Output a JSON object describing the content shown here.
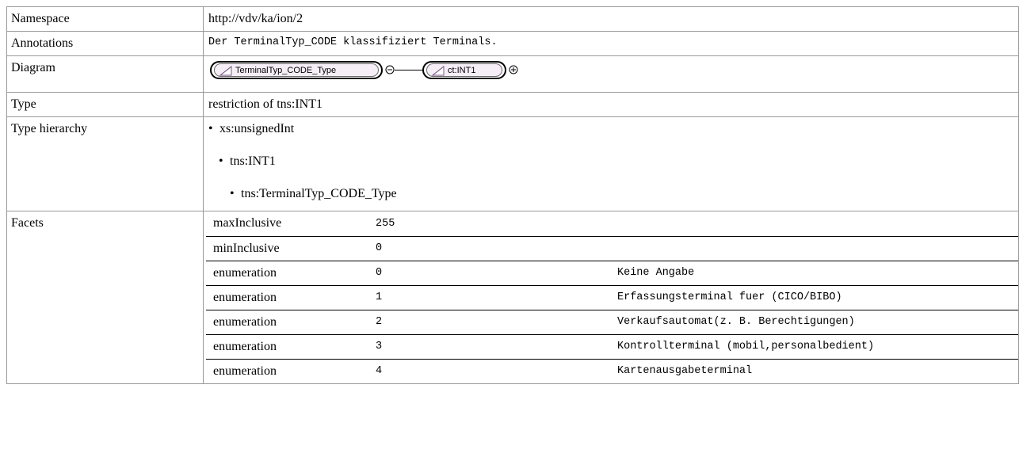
{
  "rows": {
    "namespace": {
      "label": "Namespace",
      "value": "http://vdv/ka/ion/2"
    },
    "annotations": {
      "label": "Annotations",
      "value": "Der TerminalTyp_CODE klassifiziert Terminals."
    },
    "diagram": {
      "label": "Diagram",
      "node1": "TerminalTyp_CODE_Type",
      "node2": "ct:INT1"
    },
    "type": {
      "label": "Type",
      "value": "restriction of tns:INT1"
    },
    "hierarchy": {
      "label": "Type hierarchy",
      "items": [
        "xs:unsignedInt",
        "tns:INT1",
        "tns:TerminalTyp_CODE_Type"
      ]
    },
    "facets": {
      "label": "Facets",
      "rows": [
        {
          "name": "maxInclusive",
          "value": "255",
          "desc": ""
        },
        {
          "name": "minInclusive",
          "value": "0",
          "desc": ""
        },
        {
          "name": "enumeration",
          "value": "0",
          "desc": "Keine Angabe"
        },
        {
          "name": "enumeration",
          "value": "1",
          "desc": "Erfassungsterminal fuer (CICO/BIBO)"
        },
        {
          "name": "enumeration",
          "value": "2",
          "desc": "Verkaufsautomat(z. B. Berechtigungen)"
        },
        {
          "name": "enumeration",
          "value": "3",
          "desc": "Kontrollterminal (mobil,personalbedient)"
        },
        {
          "name": "enumeration",
          "value": "4",
          "desc": "Kartenausgabeterminal"
        }
      ]
    }
  }
}
